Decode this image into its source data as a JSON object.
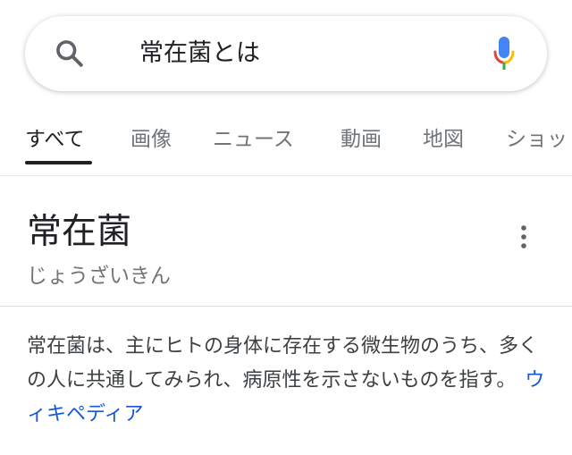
{
  "search": {
    "query": "常在菌とは",
    "search_icon": "search-icon",
    "mic_icon": "mic-icon"
  },
  "tabs": [
    {
      "label": "すべて",
      "active": true
    },
    {
      "label": "画像",
      "active": false
    },
    {
      "label": "ニュース",
      "active": false
    },
    {
      "label": "動画",
      "active": false
    },
    {
      "label": "地図",
      "active": false
    },
    {
      "label": "ショッ",
      "active": false
    }
  ],
  "knowledge_panel": {
    "title": "常在菌",
    "reading": "じょうざいきん",
    "more_icon": "more-vert-icon",
    "description": "常在菌は、主にヒトの身体に存在する微生物のうち、多くの人に共通してみられ、病原性を示さないものを指す。",
    "source_link": "ウィキペディア"
  },
  "colors": {
    "link": "#1558d6",
    "text": "#202124",
    "secondary": "#70757a"
  }
}
